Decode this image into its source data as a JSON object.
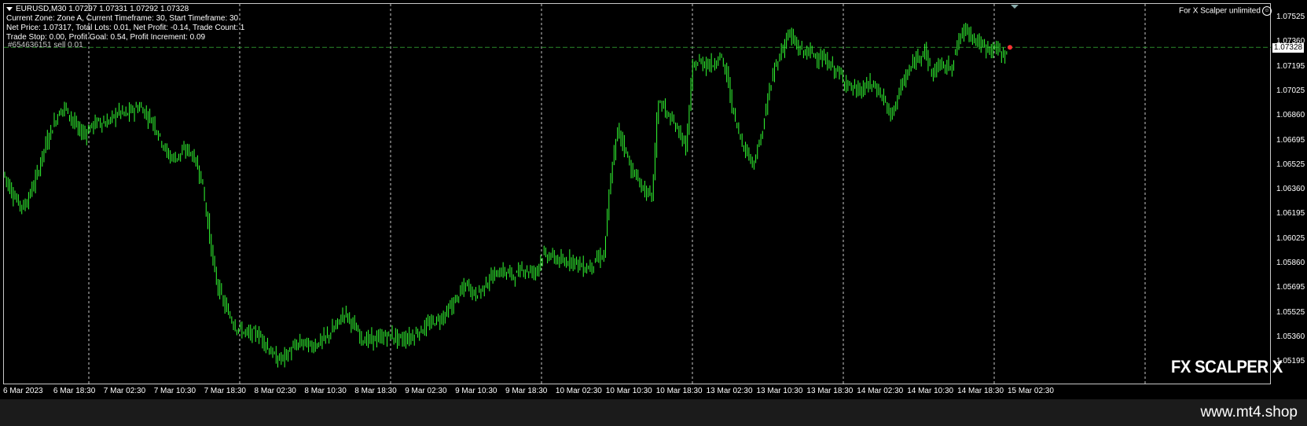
{
  "header": {
    "symbol_line": "EURUSD,M30  1.07297 1.07331 1.07292 1.07328",
    "info_lines": [
      "Current Zone: Zone A, Current Timeframe: 30, Start Timeframe: 30",
      "Net Price: 1.07317, Total Lots: 0.01, Net Profit: -0.14, Trade Count: 1",
      "Trade Stop: 0.00, Profit Goal: 0.54, Profit Increment: 0.09"
    ],
    "order_line": "#654636151 sell 0.01"
  },
  "ea_label": "For X Scalper unlimited",
  "current_price": "1.07328",
  "price_axis": [
    "1.07525",
    "1.07360",
    "1.07195",
    "1.07025",
    "1.06860",
    "1.06695",
    "1.06525",
    "1.06360",
    "1.06195",
    "1.06025",
    "1.05860",
    "1.05695",
    "1.05525",
    "1.05360",
    "1.05195"
  ],
  "time_axis": [
    "6 Mar 2023",
    "6 Mar 18:30",
    "7 Mar 02:30",
    "7 Mar 10:30",
    "7 Mar 18:30",
    "8 Mar 02:30",
    "8 Mar 10:30",
    "8 Mar 18:30",
    "9 Mar 02:30",
    "9 Mar 10:30",
    "9 Mar 18:30",
    "10 Mar 02:30",
    "10 Mar 10:30",
    "10 Mar 18:30",
    "13 Mar 02:30",
    "13 Mar 10:30",
    "13 Mar 18:30",
    "14 Mar 02:30",
    "14 Mar 10:30",
    "14 Mar 18:30",
    "15 Mar 02:30"
  ],
  "watermark": "FX SCALPER X",
  "footer_site": "www.mt4.shop",
  "colors": {
    "candle": "#33ff33",
    "background": "#000000",
    "grid": "#c8c8c8",
    "order_line": "#2a8a2a"
  },
  "chart_data": {
    "type": "line",
    "series": [
      {
        "values": [
          1.0653,
          1.0643,
          1.0635,
          1.0631,
          1.064,
          1.0652,
          1.0668,
          1.068,
          1.069,
          1.0695,
          1.0688,
          1.068,
          1.0678,
          1.0683,
          1.0686,
          1.0684,
          1.0688,
          1.0692,
          1.069,
          1.0693,
          1.0695,
          1.069,
          1.0685,
          1.0675,
          1.0665,
          1.0662,
          1.0665,
          1.0668,
          1.0662,
          1.065,
          1.062,
          1.0588,
          1.0573,
          1.0563,
          1.0555,
          1.0552,
          1.055,
          1.0551,
          1.0547,
          1.054,
          1.0534,
          1.0535,
          1.0539,
          1.0543,
          1.0545,
          1.0542,
          1.0544,
          1.0547,
          1.0551,
          1.0557,
          1.0564,
          1.0558,
          1.055,
          1.0546,
          1.0547,
          1.0547,
          1.0549,
          1.0549,
          1.0547,
          1.0547,
          1.0549,
          1.0552,
          1.0555,
          1.0558,
          1.056,
          1.0564,
          1.057,
          1.0577,
          1.0582,
          1.0575,
          1.0578,
          1.0584,
          1.0588,
          1.059,
          1.0589,
          1.0587,
          1.0592,
          1.059,
          1.059,
          1.06,
          1.06,
          1.0598,
          1.0595,
          1.0598,
          1.0596,
          1.0592,
          1.0593,
          1.0598,
          1.06,
          1.065,
          1.068,
          1.067,
          1.0655,
          1.0648,
          1.0641,
          1.0637,
          1.07,
          1.0692,
          1.0685,
          1.068,
          1.0668,
          1.072,
          1.0724,
          1.0722,
          1.0722,
          1.0728,
          1.0715,
          1.069,
          1.0675,
          1.0665,
          1.066,
          1.0675,
          1.07,
          1.072,
          1.073,
          1.0742,
          1.0735,
          1.073,
          1.073,
          1.0728,
          1.0725,
          1.0722,
          1.0718,
          1.0713,
          1.0708,
          1.0705,
          1.0706,
          1.071,
          1.0706,
          1.07,
          1.0688,
          1.0702,
          1.0712,
          1.072,
          1.0727,
          1.0732,
          1.0715,
          1.0722,
          1.072,
          1.0722,
          1.0738,
          1.0745,
          1.074,
          1.0735,
          1.0732,
          1.0733,
          1.073,
          1.0728
        ]
      }
    ],
    "ylim": [
      1.05195,
      1.076
    ],
    "grid": true
  }
}
